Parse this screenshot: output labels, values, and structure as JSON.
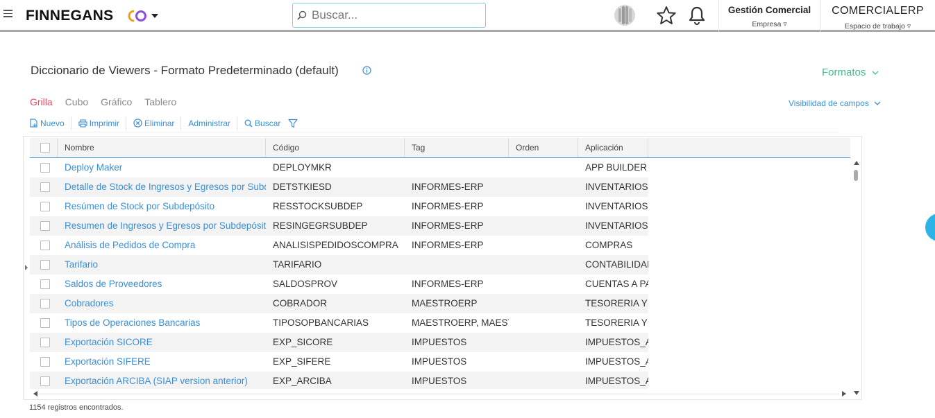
{
  "header": {
    "logo_text": "FINNEGANS",
    "logo_mark": "CO",
    "search_placeholder": "Buscar...",
    "company": {
      "title": "Gestión Comercial",
      "sub": "Empresa"
    },
    "workspace": {
      "title": "COMERCIALERP",
      "sub": "Espacio de trabajo"
    }
  },
  "page": {
    "title": "Diccionario de Viewers - Formato Predeterminado (default)",
    "formats_label": "Formatos",
    "field_visibility_label": "Visibilidad de campos"
  },
  "tabs": [
    {
      "label": "Grilla",
      "active": true
    },
    {
      "label": "Cubo",
      "active": false
    },
    {
      "label": "Gráfico",
      "active": false
    },
    {
      "label": "Tablero",
      "active": false
    }
  ],
  "toolbar": {
    "new_label": "Nuevo",
    "print_label": "Imprimir",
    "delete_label": "Eliminar",
    "admin_label": "Administrar",
    "search_label": "Buscar"
  },
  "grid": {
    "columns": [
      "Nombre",
      "Código",
      "Tag",
      "Orden",
      "Aplicación"
    ],
    "rows": [
      [
        "Deploy Maker",
        "DEPLOYMKR",
        "",
        "",
        "APP BUILDER"
      ],
      [
        "Detalle de Stock de Ingresos y Egresos por Subdepósito",
        "DETSTKIESD",
        "INFORMES-ERP",
        "",
        "INVENTARIOS"
      ],
      [
        "Resúmen de Stock por Subdepósito",
        "RESSTOCKSUBDEP",
        "INFORMES-ERP",
        "",
        "INVENTARIOS"
      ],
      [
        "Resumen de Ingresos y Egresos por Subdepósito",
        "RESINGEGRSUBDEP",
        "INFORMES-ERP",
        "",
        "INVENTARIOS"
      ],
      [
        "Análisis de Pedidos de Compra",
        "ANALISISPEDIDOSCOMPRA",
        "INFORMES-ERP",
        "",
        "COMPRAS"
      ],
      [
        "Tarifario",
        "TARIFARIO",
        "",
        "",
        "CONTABILIDAD"
      ],
      [
        "Saldos de Proveedores",
        "SALDOSPROV",
        "INFORMES-ERP",
        "",
        "CUENTAS A PAGAR"
      ],
      [
        "Cobradores",
        "COBRADOR",
        "MAESTROERP",
        "",
        "TESORERIA Y BANCOS"
      ],
      [
        "Tipos de Operaciones Bancarias",
        "TIPOSOPBANCARIAS",
        "MAESTROERP, MAESTRO",
        "",
        "TESORERIA Y BANCOS"
      ],
      [
        "Exportación SICORE",
        "EXP_SICORE",
        "IMPUESTOS",
        "",
        "IMPUESTOS_AR"
      ],
      [
        "Exportación SIFERE",
        "EXP_SIFERE",
        "IMPUESTOS",
        "",
        "IMPUESTOS_AR"
      ],
      [
        "Exportación ARCIBA (SIAP version anterior)",
        "EXP_ARCIBA",
        "IMPUESTOS",
        "",
        "IMPUESTOS_AR"
      ]
    ],
    "footer": "1154 registros encontrados."
  }
}
